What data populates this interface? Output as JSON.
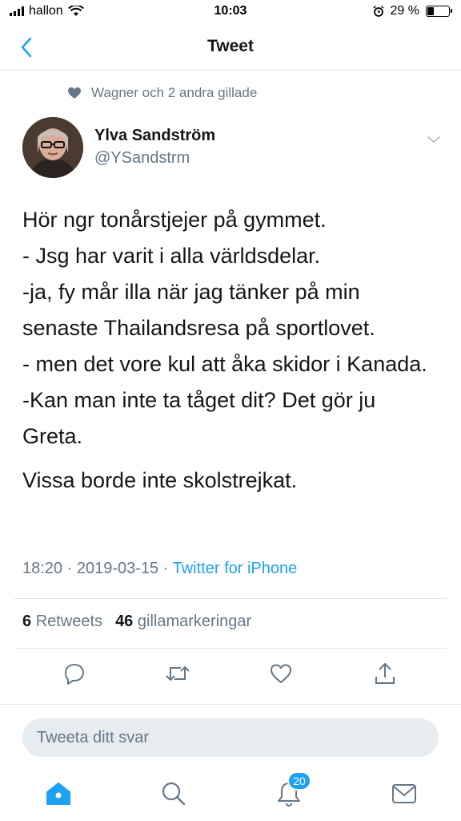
{
  "status_bar": {
    "carrier": "hallon",
    "time": "10:03",
    "battery_percent_text": "29 %",
    "battery_level": 0.29
  },
  "nav": {
    "title": "Tweet",
    "back_icon": "chevron-left-icon"
  },
  "social_context": {
    "icon": "heart-icon",
    "text": "Wagner och 2 andra gillade"
  },
  "author": {
    "name": "Ylva Sandström",
    "handle": "@YSandstrm"
  },
  "tweet": {
    "paragraph1": "Hör ngr tonårstjejer på gymmet.\n- Jsg har varit i alla världsdelar.\n-ja, fy mår illa när jag tänker på min senaste Thailandsresa på sportlovet.\n- men det vore kul att åka skidor i Kanada.\n-Kan man inte ta tåget dit? Det gör ju Greta.",
    "paragraph2": "Vissa borde inte skolstrejkat.",
    "time": "18:20",
    "date": "2019-03-15",
    "source": "Twitter for iPhone"
  },
  "stats": {
    "retweets_count": "6",
    "retweets_label": "Retweets",
    "likes_count": "46",
    "likes_label": "gillamarkeringar"
  },
  "actions": [
    "reply-icon",
    "retweet-icon",
    "like-icon",
    "share-icon"
  ],
  "reply_box": {
    "placeholder": "Tweeta ditt svar"
  },
  "tab_bar": {
    "items": [
      "home-icon",
      "search-icon",
      "notifications-icon",
      "messages-icon"
    ],
    "notifications_badge": "20"
  },
  "colors": {
    "accent": "#1da1f2",
    "secondary_text": "#657786",
    "primary_text": "#14171a",
    "divider": "#e1e8ed"
  }
}
